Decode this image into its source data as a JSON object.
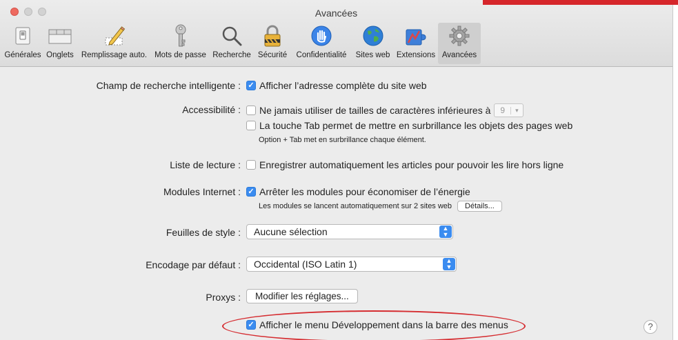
{
  "window": {
    "title": "Avancées"
  },
  "toolbar": {
    "tabs": [
      {
        "label": "Générales",
        "icon": "general-switch-icon"
      },
      {
        "label": "Onglets",
        "icon": "tabs-icon"
      },
      {
        "label": "Remplissage auto.",
        "icon": "pencil-icon"
      },
      {
        "label": "Mots de passe",
        "icon": "key-icon"
      },
      {
        "label": "Recherche",
        "icon": "search-icon"
      },
      {
        "label": "Sécurité",
        "icon": "padlock-icon"
      },
      {
        "label": "Confidentialité",
        "icon": "hand-icon"
      },
      {
        "label": "Sites web",
        "icon": "globe-icon"
      },
      {
        "label": "Extensions",
        "icon": "puzzle-icon"
      },
      {
        "label": "Avancées",
        "icon": "gear-icon"
      }
    ],
    "active_tab": "Avancées"
  },
  "settings": {
    "smart_search": {
      "label": "Champ de recherche intelligente :",
      "option": "Afficher l’adresse complète du site web",
      "checked": true
    },
    "accessibility": {
      "label": "Accessibilité :",
      "option1": "Ne jamais utiliser de tailles de caractères inférieures à",
      "font_size": "9",
      "option2": "La touche Tab permet de mettre en surbrillance les objets des pages web",
      "hint": "Option + Tab met en surbrillance chaque élément."
    },
    "reading_list": {
      "label": "Liste de lecture :",
      "option": "Enregistrer automatiquement les articles pour pouvoir les lire hors ligne"
    },
    "plugins": {
      "label": "Modules Internet :",
      "option": "Arrêter les modules pour économiser de l’énergie",
      "note": "Les modules se lancent automatiquement sur 2 sites web",
      "details_button": "Détails..."
    },
    "stylesheet": {
      "label": "Feuilles de style :",
      "value": "Aucune sélection"
    },
    "encoding": {
      "label": "Encodage par défaut :",
      "value": "Occidental (ISO Latin 1)"
    },
    "proxies": {
      "label": "Proxys :",
      "button": "Modifier les réglages..."
    },
    "develop_menu": {
      "option": "Afficher le menu Développement dans la barre des menus",
      "checked": true
    }
  },
  "help": {
    "glyph": "?"
  },
  "colors": {
    "accent": "#3b8cf0",
    "highlight_ellipse": "#d52c30",
    "close_button": "#ee6a60"
  }
}
